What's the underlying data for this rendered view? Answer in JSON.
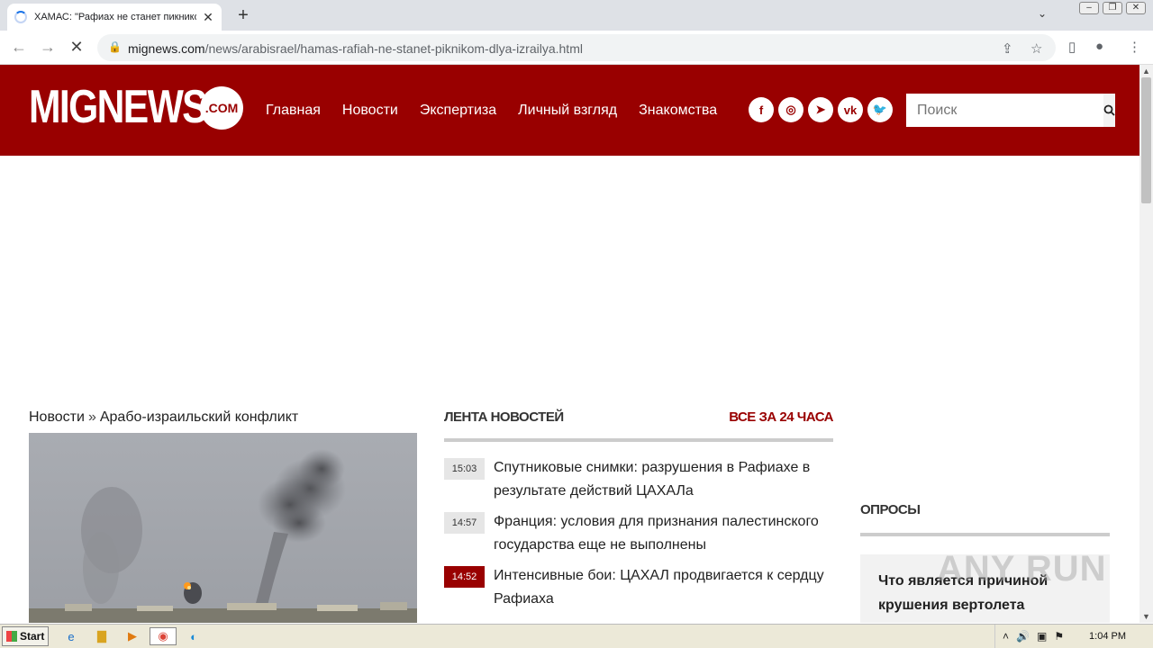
{
  "browser": {
    "tab_title": "ХАМАС: \"Рафиах не станет пикникомдля Израиля\"",
    "url_host": "mignews.com",
    "url_path": "/news/arabisrael/hamas-rafiah-ne-stanet-piknikom-dlya-izrailya.html"
  },
  "site": {
    "logo_text": "MIGNEWS",
    "logo_suffix": ".COM",
    "menu": [
      "Главная",
      "Новости",
      "Экспертиза",
      "Личный взгляд",
      "Знакомства"
    ],
    "socials": [
      "facebook-icon",
      "instagram-icon",
      "telegram-icon",
      "vk-icon",
      "twitter-icon"
    ],
    "search_placeholder": "Поиск",
    "brand_color": "#990000"
  },
  "breadcrumb": {
    "items": [
      "Новости",
      "Арабо-израильский конфликт"
    ],
    "separator": "»"
  },
  "feed": {
    "title": "ЛЕНТА НОВОСТЕЙ",
    "all_link": "ВСЕ ЗА 24 ЧАСА",
    "items": [
      {
        "time": "15:03",
        "text": "Спутниковые снимки: разрушения в Рафиахе в результате действий ЦАХАЛа",
        "highlight": false
      },
      {
        "time": "14:57",
        "text": "Франция: условия для признания палестинского государства еще не выполнены",
        "highlight": false
      },
      {
        "time": "14:52",
        "text": "Интенсивные бои: ЦАХАЛ продвигается к сердцу Рафиаха",
        "highlight": true
      }
    ]
  },
  "polls": {
    "title": "ОПРОСЫ",
    "question": "Что является причиной крушения вертолета"
  },
  "watermark": "ANY RUN",
  "taskbar": {
    "start_label": "Start",
    "clock": "1:04 PM"
  }
}
